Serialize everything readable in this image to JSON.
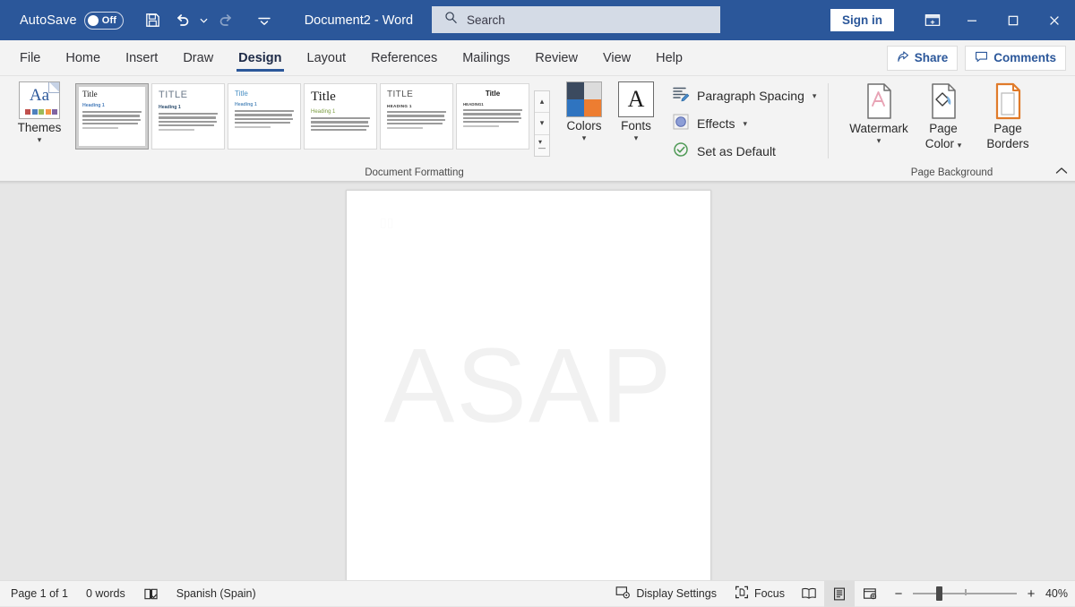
{
  "titlebar": {
    "autosave_label": "AutoSave",
    "autosave_state": "Off",
    "save_icon": "save-icon",
    "undo_icon": "undo-icon",
    "redo_icon": "redo-icon",
    "customize_icon": "customize-quick-access-icon",
    "document_title": "Document2  -  Word",
    "search_placeholder": "Search",
    "search_icon": "search-icon",
    "sign_in_label": "Sign in",
    "ribbon_display_icon": "ribbon-display-options-icon",
    "minimize_icon": "minimize-icon",
    "maximize_icon": "maximize-icon",
    "close_icon": "close-icon",
    "accent_color": "#2b579a"
  },
  "tabs": [
    {
      "label": "File",
      "active": false
    },
    {
      "label": "Home",
      "active": false
    },
    {
      "label": "Insert",
      "active": false
    },
    {
      "label": "Draw",
      "active": false
    },
    {
      "label": "Design",
      "active": true
    },
    {
      "label": "Layout",
      "active": false
    },
    {
      "label": "References",
      "active": false
    },
    {
      "label": "Mailings",
      "active": false
    },
    {
      "label": "Review",
      "active": false
    },
    {
      "label": "View",
      "active": false
    },
    {
      "label": "Help",
      "active": false
    }
  ],
  "tab_actions": {
    "share_label": "Share",
    "share_icon": "share-icon",
    "comments_label": "Comments",
    "comments_icon": "comment-icon"
  },
  "ribbon": {
    "themes": {
      "label": "Themes",
      "icon": "themes-aa-icon",
      "dropdown_icon": "chevron-down-icon",
      "swatch_colors": [
        "#c0504d",
        "#4f81bd",
        "#9bbb59",
        "#f79646",
        "#8064a2"
      ]
    },
    "style_gallery": {
      "selected_index": 0,
      "items": [
        {
          "title": "Title",
          "heading": "Heading 1",
          "title_style": "serif-plain",
          "title_color": "#1a1a1a",
          "heading_color": "#4a7ebb",
          "selected": true
        },
        {
          "title": "TITLE",
          "heading": "Heading 1",
          "title_style": "caps-light",
          "title_color": "#6e7b8b",
          "heading_color": "#2f4f6f",
          "selected": false
        },
        {
          "title": "Title",
          "heading": "Heading 1",
          "title_style": "blue-light",
          "title_color": "#4a90c4",
          "heading_color": "#5a8fbf",
          "selected": false
        },
        {
          "title": "Title",
          "heading": "Heading 1",
          "title_style": "large-serif",
          "title_color": "#1a1a1a",
          "heading_color": "#7a9c3f",
          "selected": false
        },
        {
          "title": "TITLE",
          "heading": "HEADING 1",
          "title_style": "caps-gray",
          "title_color": "#555555",
          "heading_color": "#333333",
          "selected": false
        },
        {
          "title": "Title",
          "heading": "HEADING1",
          "title_style": "center-bold",
          "title_color": "#1a1a1a",
          "heading_color": "#444444",
          "selected": false
        }
      ],
      "scroll_up_icon": "chevron-up-icon",
      "scroll_down_icon": "chevron-down-icon",
      "more_icon": "more-styles-icon"
    },
    "colors": {
      "label": "Colors",
      "icon": "theme-colors-icon",
      "dropdown_icon": "chevron-down-icon",
      "quadrants": [
        "#3b4a5f",
        "#dcdcdc",
        "#2f74c0",
        "#ed7d31"
      ]
    },
    "fonts": {
      "label": "Fonts",
      "icon": "theme-fonts-icon",
      "glyph": "A",
      "dropdown_icon": "chevron-down-icon"
    },
    "paragraph_spacing": {
      "label": "Paragraph Spacing",
      "icon": "paragraph-spacing-icon",
      "dropdown_icon": "chevron-down-icon"
    },
    "effects": {
      "label": "Effects",
      "icon": "effects-icon",
      "dropdown_icon": "chevron-down-icon"
    },
    "set_as_default": {
      "label": "Set as Default",
      "icon": "set-as-default-icon"
    },
    "group_label_document_formatting": "Document Formatting",
    "watermark": {
      "label": "Watermark",
      "icon": "watermark-icon",
      "dropdown_icon": "chevron-down-icon"
    },
    "page_color": {
      "label_line1": "Page",
      "label_line2": "Color",
      "icon": "page-color-icon",
      "dropdown_icon": "chevron-down-icon"
    },
    "page_borders": {
      "label_line1": "Page",
      "label_line2": "Borders",
      "icon": "page-borders-icon"
    },
    "group_label_page_background": "Page Background",
    "collapse_icon": "collapse-ribbon-icon"
  },
  "document": {
    "watermark_text": "ASAP",
    "watermark_color": "#f1f1f1",
    "page_background": "#ffffff"
  },
  "statusbar": {
    "page_count": "Page 1 of 1",
    "word_count": "0 words",
    "proofing_icon": "proofing-errors-icon",
    "language": "Spanish (Spain)",
    "display_settings_label": "Display Settings",
    "display_settings_icon": "display-settings-icon",
    "focus_label": "Focus",
    "focus_icon": "focus-mode-icon",
    "view_read_icon": "read-mode-icon",
    "view_print_icon": "print-layout-icon",
    "view_web_icon": "web-layout-icon",
    "active_view": "print-layout",
    "zoom_out_icon": "zoom-out-icon",
    "zoom_in_icon": "zoom-in-icon",
    "zoom_level": "40%"
  }
}
